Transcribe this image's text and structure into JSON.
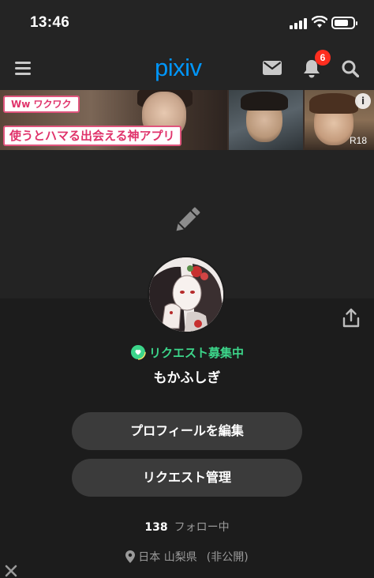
{
  "status_bar": {
    "time": "13:46"
  },
  "header": {
    "logo": "pixiv",
    "notification_count": "6",
    "icons": [
      "menu-icon",
      "mail-icon",
      "bell-icon",
      "search-icon"
    ]
  },
  "ad": {
    "tag_top": "Ww ワクワク",
    "headline": "使うとハマる出会える神アプリ",
    "rating": "R18",
    "info_glyph": "i"
  },
  "profile": {
    "request_status": "リクエスト募集中",
    "username": "もかふしぎ",
    "edit_profile_label": "プロフィールを編集",
    "request_manage_label": "リクエスト管理",
    "following_count": "138",
    "following_label": "フォロー中",
    "location": "日本 山梨県",
    "location_privacy": "(非公開)"
  },
  "colors": {
    "background": "#1c1c1c",
    "accent": "#0096fa",
    "badge": "#ff2e1f",
    "request_green": "#3cd58a",
    "button": "#3b3b3b"
  }
}
